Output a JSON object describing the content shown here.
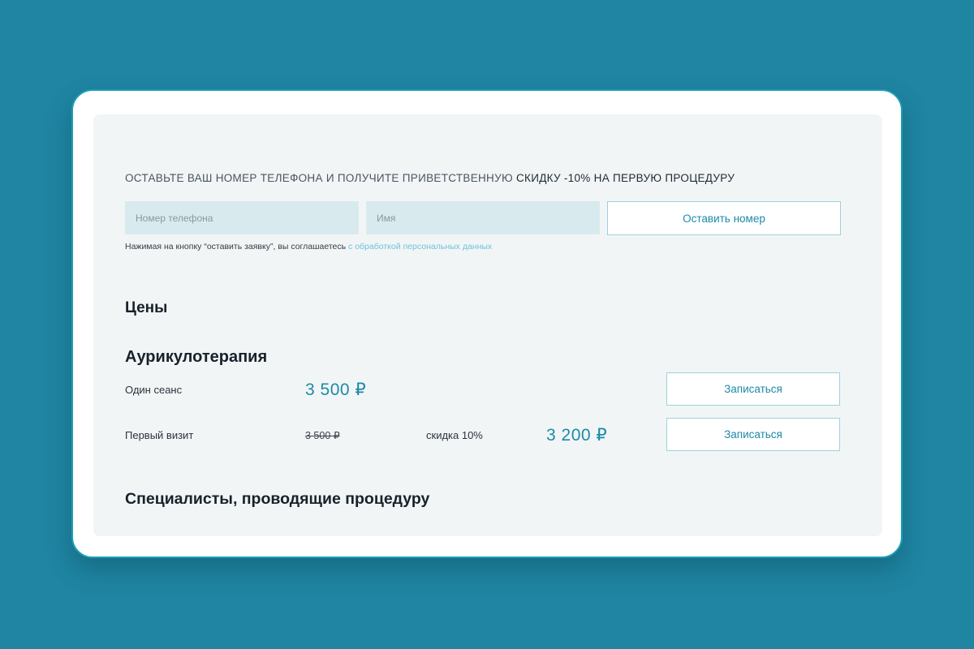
{
  "promo": {
    "text_light": "ОСТАВЬТЕ ВАШ НОМЕР ТЕЛЕФОНА И ПОЛУЧИТЕ ПРИВЕТСТВЕННУЮ",
    "text_strong": "СКИДКУ -10% НА ПЕРВУЮ ПРОЦЕДУРУ"
  },
  "form": {
    "phone_placeholder": "Номер телефона",
    "name_placeholder": "Имя",
    "submit_label": "Оставить номер",
    "consent_text": "Нажимая на кнопку “оставить заявку”, вы соглашаетесь ",
    "consent_link": "с обработкой персональных данных"
  },
  "prices": {
    "heading": "Цены",
    "service_name": "Аурикулотерапия",
    "rows": [
      {
        "label": "Один сеанс",
        "price": "3 500 ₽",
        "button_label": "Записаться"
      },
      {
        "label": "Первый визит",
        "old_price": "3 500 ₽",
        "discount_label": "скидка 10%",
        "price": "3 200 ₽",
        "button_label": "Записаться"
      }
    ]
  },
  "specialists": {
    "heading": "Специалисты, проводящие процедуру"
  },
  "colors": {
    "background": "#1f85a2",
    "accent": "#1c8aa8",
    "link": "#6ec3d8",
    "field_bg": "#d9eaee",
    "panel_bg": "#f2f5f6"
  }
}
